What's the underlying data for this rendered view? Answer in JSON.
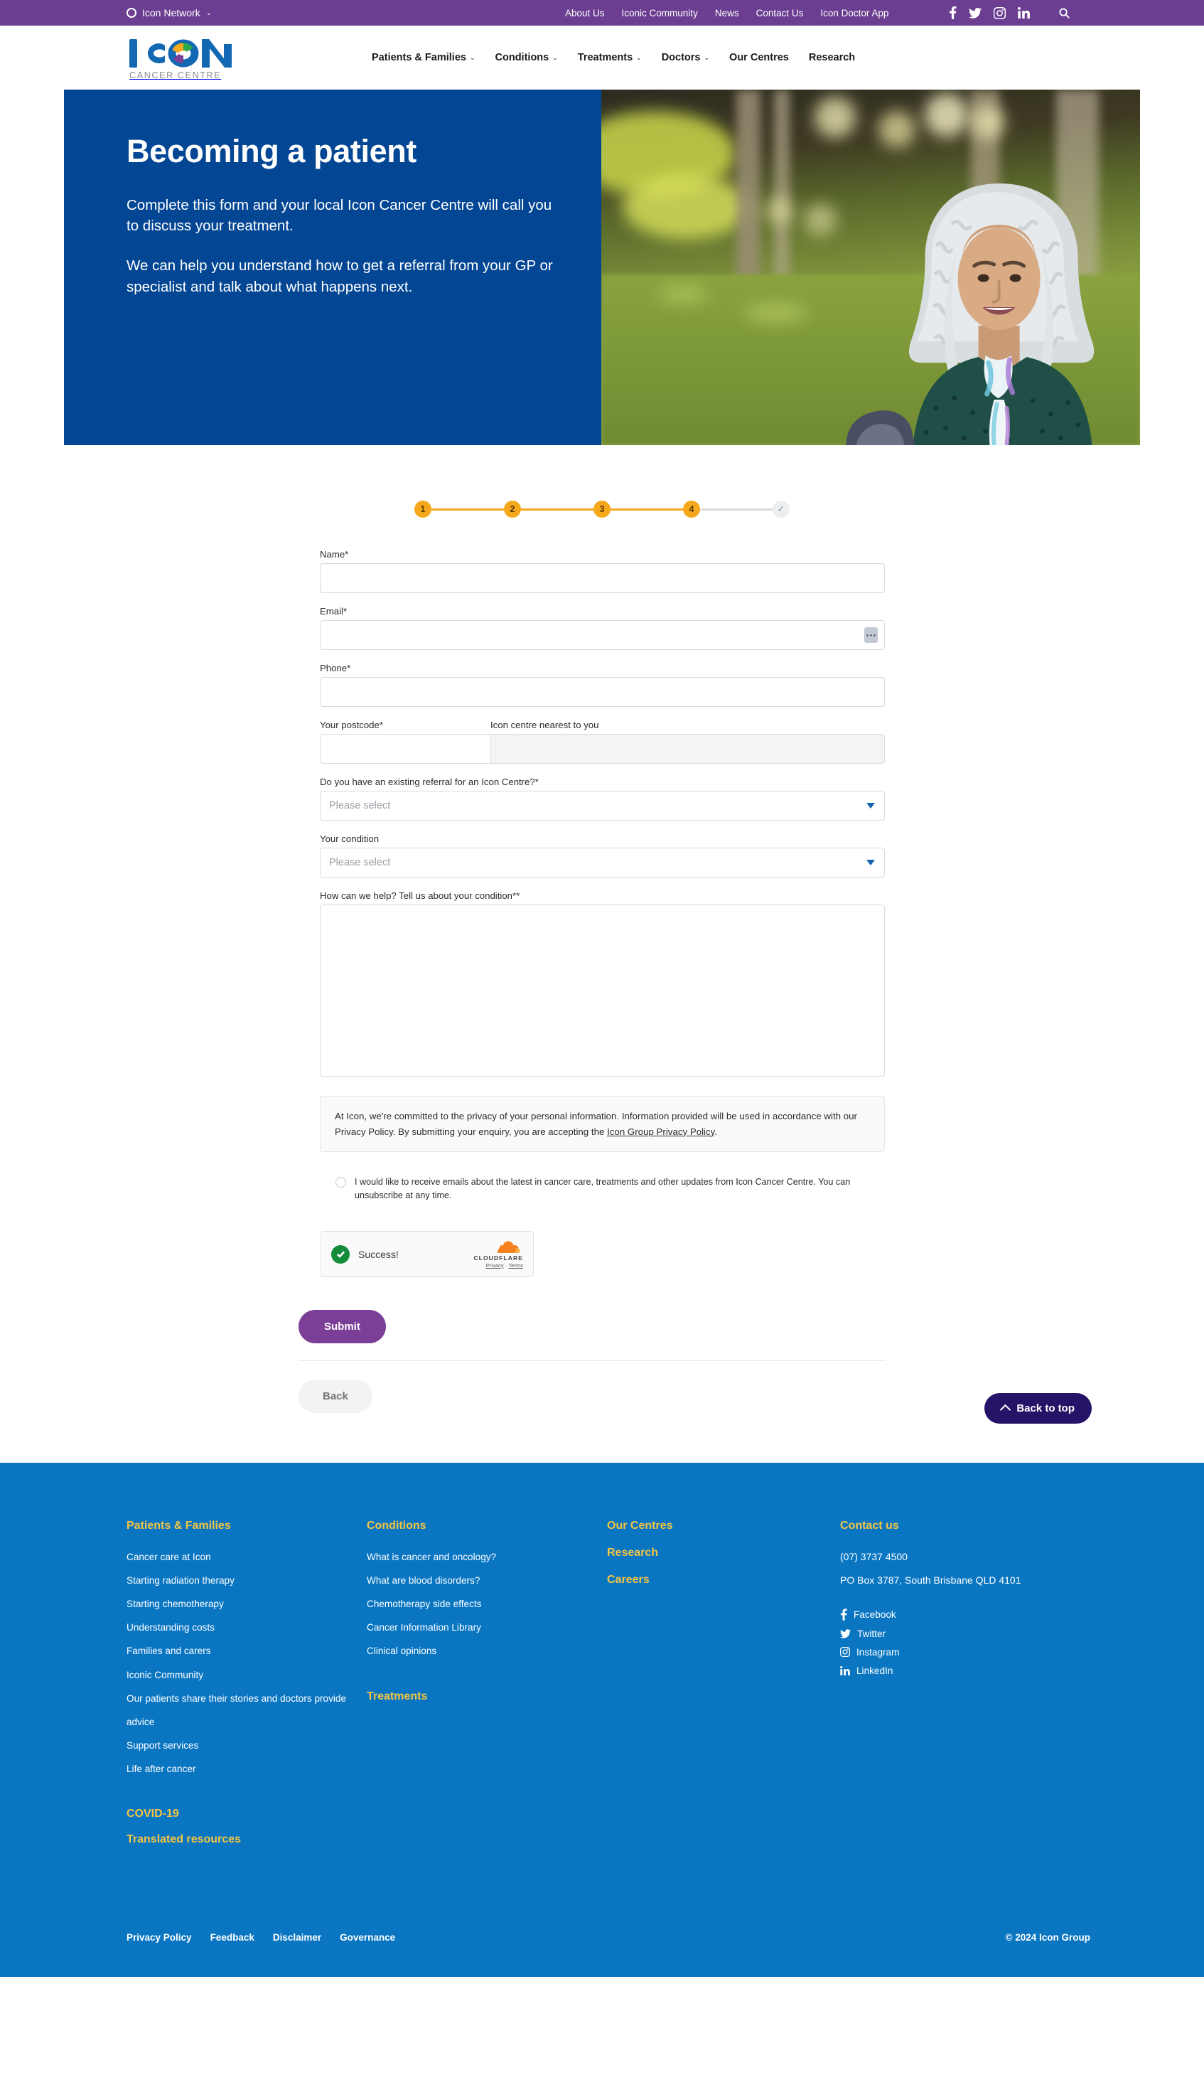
{
  "topbar": {
    "network_label": "Icon Network",
    "network_icon": "ring-icon",
    "caret": "⌄",
    "nav": [
      {
        "label": "About Us"
      },
      {
        "label": "Iconic Community"
      },
      {
        "label": "News"
      },
      {
        "label": "Contact Us"
      },
      {
        "label": "Icon Doctor App"
      }
    ],
    "social": [
      "facebook-icon",
      "twitter-icon",
      "instagram-icon",
      "linkedin-icon"
    ],
    "search_icon": "search-icon",
    "bg_color": "#6B3E91"
  },
  "header": {
    "logo_word": "ICON",
    "logo_sub": "CANCER CENTRE",
    "nav": [
      {
        "label": "Patients & Families",
        "caret": "⌄"
      },
      {
        "label": "Conditions",
        "caret": "⌄"
      },
      {
        "label": "Treatments",
        "caret": "⌄"
      },
      {
        "label": "Doctors",
        "caret": "⌄"
      },
      {
        "label": "Our Centres",
        "caret": ""
      },
      {
        "label": "Research",
        "caret": ""
      }
    ]
  },
  "hero": {
    "title": "Becoming a patient",
    "paragraph1": "Complete this form and your local Icon Cancer Centre will call you to discuss your treatment.",
    "paragraph2": "We can help you understand how to get a referral from your GP or specialist and talk about what happens next.",
    "bg_color": "#034694",
    "image_alt": "Smiling woman with silver curly hair sitting in a park"
  },
  "steps": {
    "items": [
      "1",
      "2",
      "3",
      "4"
    ],
    "check_glyph": "✓",
    "active_color": "#F5A81C",
    "inactive_color": "#dcdcdc"
  },
  "form": {
    "name": {
      "label": "Name*",
      "value": "",
      "placeholder": ""
    },
    "email": {
      "label": "Email*",
      "value": "",
      "placeholder": "",
      "icon": "autofill-icon"
    },
    "phone": {
      "label": "Phone*",
      "value": "",
      "placeholder": ""
    },
    "postcode": {
      "label": "Your postcode*",
      "value": "",
      "placeholder": ""
    },
    "centre": {
      "label": "Icon centre nearest to you",
      "value": "",
      "placeholder": ""
    },
    "referral": {
      "label": "Do you have an existing referral for an Icon Centre?*",
      "selected": "Please select"
    },
    "condition": {
      "label": "Your condition",
      "selected": "Please select"
    },
    "help": {
      "label": "How can we help? Tell us about your condition**",
      "value": "",
      "placeholder": ""
    },
    "privacy_text_1": "At Icon, we're committed to the privacy of your personal information. Information provided will be used in accordance with our Privacy Policy. By submitting your enquiry, you are accepting the ",
    "privacy_link": "Icon Group Privacy Policy",
    "privacy_text_2": ".",
    "optin_text": "I would like to receive emails about the latest in cancer care, treatments and other updates from Icon Cancer Centre. You can unsubscribe at any time.",
    "submit_label": "Submit",
    "back_label": "Back",
    "submit_color": "#7B3F98"
  },
  "turnstile": {
    "status": "Success!",
    "brand": "CLOUDFLARE",
    "privacy_link": "Privacy",
    "separator": " · ",
    "terms_link": "Terms",
    "check_icon": "check-circle-icon"
  },
  "back_to_top": {
    "label": "Back to top",
    "icon": "chevron-up-icon",
    "bg_color": "#241366"
  },
  "footer": {
    "bg_color": "#0A76C2",
    "heading_color": "#F5C542",
    "col1": {
      "heading": "Patients & Families",
      "links": [
        "Cancer care at Icon",
        "Starting radiation therapy",
        "Starting chemotherapy",
        "Understanding costs",
        "Families and carers",
        "Iconic Community",
        "Our patients share their stories and doctors provide advice",
        "Support services",
        "Life after cancer"
      ],
      "extra_headings": [
        "COVID-19",
        "Translated resources"
      ]
    },
    "col2": {
      "heading": "Conditions",
      "links": [
        "What is cancer and oncology?",
        "What are blood disorders?",
        "Chemotherapy side effects",
        "Cancer Information Library",
        "Clinical opinions"
      ],
      "extra_headings": [
        "Treatments"
      ]
    },
    "col3": {
      "headings": [
        "Our Centres",
        "Research",
        "Careers"
      ]
    },
    "col4": {
      "heading": "Contact us",
      "phone": "(07) 3737 4500",
      "address": "PO Box 3787, South Brisbane QLD 4101",
      "social": [
        {
          "label": "Facebook",
          "icon": "facebook-icon"
        },
        {
          "label": "Twitter",
          "icon": "twitter-icon"
        },
        {
          "label": "Instagram",
          "icon": "instagram-icon"
        },
        {
          "label": "LinkedIn",
          "icon": "linkedin-icon"
        }
      ]
    },
    "bottom_links": [
      "Privacy Policy",
      "Feedback",
      "Disclaimer",
      "Governance"
    ],
    "copyright": "© 2024 Icon Group"
  }
}
